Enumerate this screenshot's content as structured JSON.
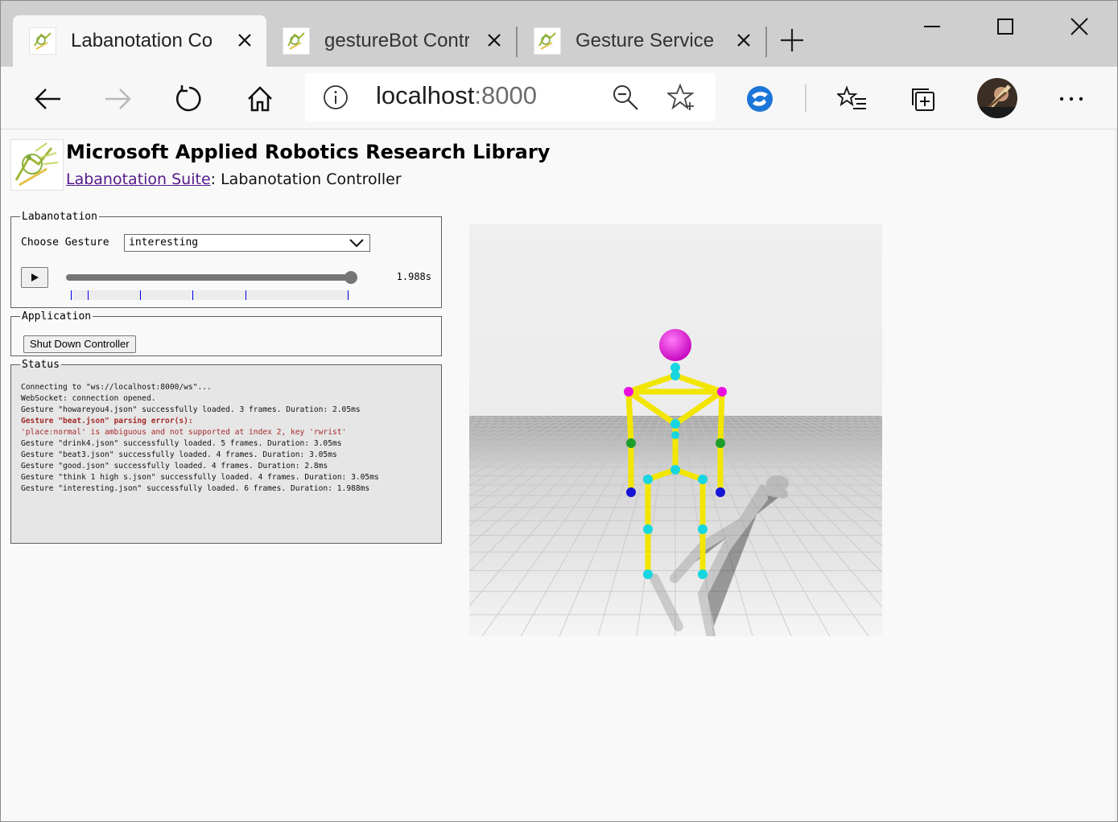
{
  "browser": {
    "tabs": [
      {
        "title": "Labanotation Co",
        "active": true
      },
      {
        "title": "gestureBot Contr",
        "active": false
      },
      {
        "title": "Gesture Service",
        "active": false
      }
    ],
    "address": {
      "host": "localhost",
      "port": ":8000"
    },
    "icons": {
      "back": "arrow-left-icon",
      "forward": "arrow-right-icon",
      "refresh": "refresh-icon",
      "home": "home-icon",
      "info": "info-icon",
      "zoom": "zoom-out-icon",
      "favorite": "star-add-icon",
      "extension": "globe-extension-icon",
      "favorites": "favorites-list-icon",
      "collections": "collections-icon",
      "more": "more-icon"
    }
  },
  "header": {
    "title": "Microsoft Applied Robotics Research Library",
    "link_text": "Labanotation Suite",
    "suffix": ": Labanotation Controller"
  },
  "labanotation": {
    "legend": "Labanotation",
    "choose_label": "Choose Gesture",
    "selected_gesture": "interesting",
    "time_value": "1.988s",
    "slider_fraction": 1.0,
    "keyframe_times": [
      0.0,
      0.06,
      0.25,
      0.44,
      0.63,
      1.0
    ]
  },
  "application": {
    "legend": "Application",
    "shutdown_label": "Shut Down Controller"
  },
  "status": {
    "legend": "Status",
    "lines": [
      {
        "text": "Connecting to \"ws://localhost:8000/ws\"...",
        "kind": "normal"
      },
      {
        "text": "WebSocket: connection opened.",
        "kind": "normal"
      },
      {
        "text": "Gesture \"howareyou4.json\" successfully loaded. 3 frames. Duration: 2.05ms",
        "kind": "normal"
      },
      {
        "text": "Gesture \"beat.json\" parsing error(s):",
        "kind": "error-bold"
      },
      {
        "text": "'place:normal' is ambiguous and not supported at index 2, key 'rwrist'",
        "kind": "error"
      },
      {
        "text": "Gesture \"drink4.json\" successfully loaded. 5 frames. Duration: 3.05ms",
        "kind": "normal"
      },
      {
        "text": "Gesture \"beat3.json\" successfully loaded. 4 frames. Duration: 3.05ms",
        "kind": "normal"
      },
      {
        "text": "Gesture \"good.json\" successfully loaded. 4 frames. Duration: 2.8ms",
        "kind": "normal"
      },
      {
        "text": "Gesture \"think 1 high s.json\" successfully loaded. 4 frames. Duration: 3.05ms",
        "kind": "normal"
      },
      {
        "text": "Gesture \"interesting.json\" successfully loaded. 6 frames. Duration: 1.988ms",
        "kind": "normal"
      }
    ]
  },
  "colors": {
    "bone": "#f2e600",
    "head": "#e80fe0",
    "joint": "#17d6e0",
    "elbow": "#1c9e2a",
    "hand": "#1515d8",
    "shoulder": "#e80fe0",
    "keyframe_tick": "#0000ee"
  }
}
